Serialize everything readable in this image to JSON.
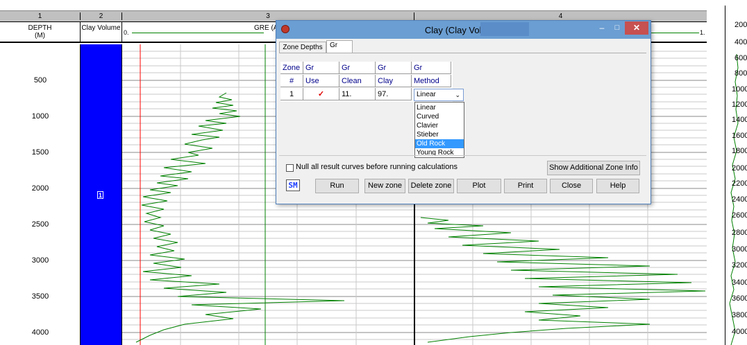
{
  "track_headers": {
    "numbers": [
      "1",
      "2",
      "3",
      "4"
    ],
    "depth_label": "DEPTH",
    "depth_unit": "(M)",
    "clay_volume_label": "Clay Volume",
    "gre_label": "GRE (A",
    "scale_min": "0.",
    "scale_max": "1."
  },
  "depth_track": {
    "labels": [
      "500",
      "1000",
      "1500",
      "2000",
      "2500",
      "3000",
      "3500",
      "4000"
    ]
  },
  "zone_marker": "1",
  "right_panel": {
    "depth_labels": [
      "200",
      "400",
      "600",
      "800",
      "1000",
      "1200",
      "1400",
      "1600",
      "1800",
      "2000",
      "2200",
      "2400",
      "2600",
      "2800",
      "3000",
      "3200",
      "3400",
      "3600",
      "3800",
      "4000"
    ]
  },
  "dialog": {
    "title": "Clay (Clay Volume)",
    "tabs": [
      "Zone Depths",
      "Gr"
    ],
    "table": {
      "header_row1": [
        "Zone",
        "Gr",
        "Gr",
        "Gr",
        "Gr"
      ],
      "header_row2": [
        "#",
        "Use",
        "Clean",
        "Clay",
        "Method"
      ],
      "row": {
        "zone": "1",
        "use": "✓",
        "clean": "11.",
        "clay": "97.",
        "method": "Linear"
      }
    },
    "method_options": [
      "Linear",
      "Curved",
      "Clavier",
      "Stieber",
      "Old Rock",
      "Young Rock"
    ],
    "highlighted_option": "Old Rock",
    "null_checkbox_label": "Null all result curves before running calculations",
    "show_info_button": "Show Additional Zone Info",
    "sm_logo": "SM",
    "buttons": {
      "run": "Run",
      "new_zone": "New zone",
      "delete_zone": "Delete zone",
      "plot": "Plot",
      "print": "Print",
      "close": "Close",
      "help": "Help"
    }
  },
  "colors": {
    "clay_fill": "#0000ff",
    "gr_curve": "#008000",
    "red_line": "#ff0000",
    "header_bg": "#c0c0c0",
    "title_bar": "#6b9ed2",
    "close_btn": "#c75050",
    "highlight": "#3399ff"
  }
}
